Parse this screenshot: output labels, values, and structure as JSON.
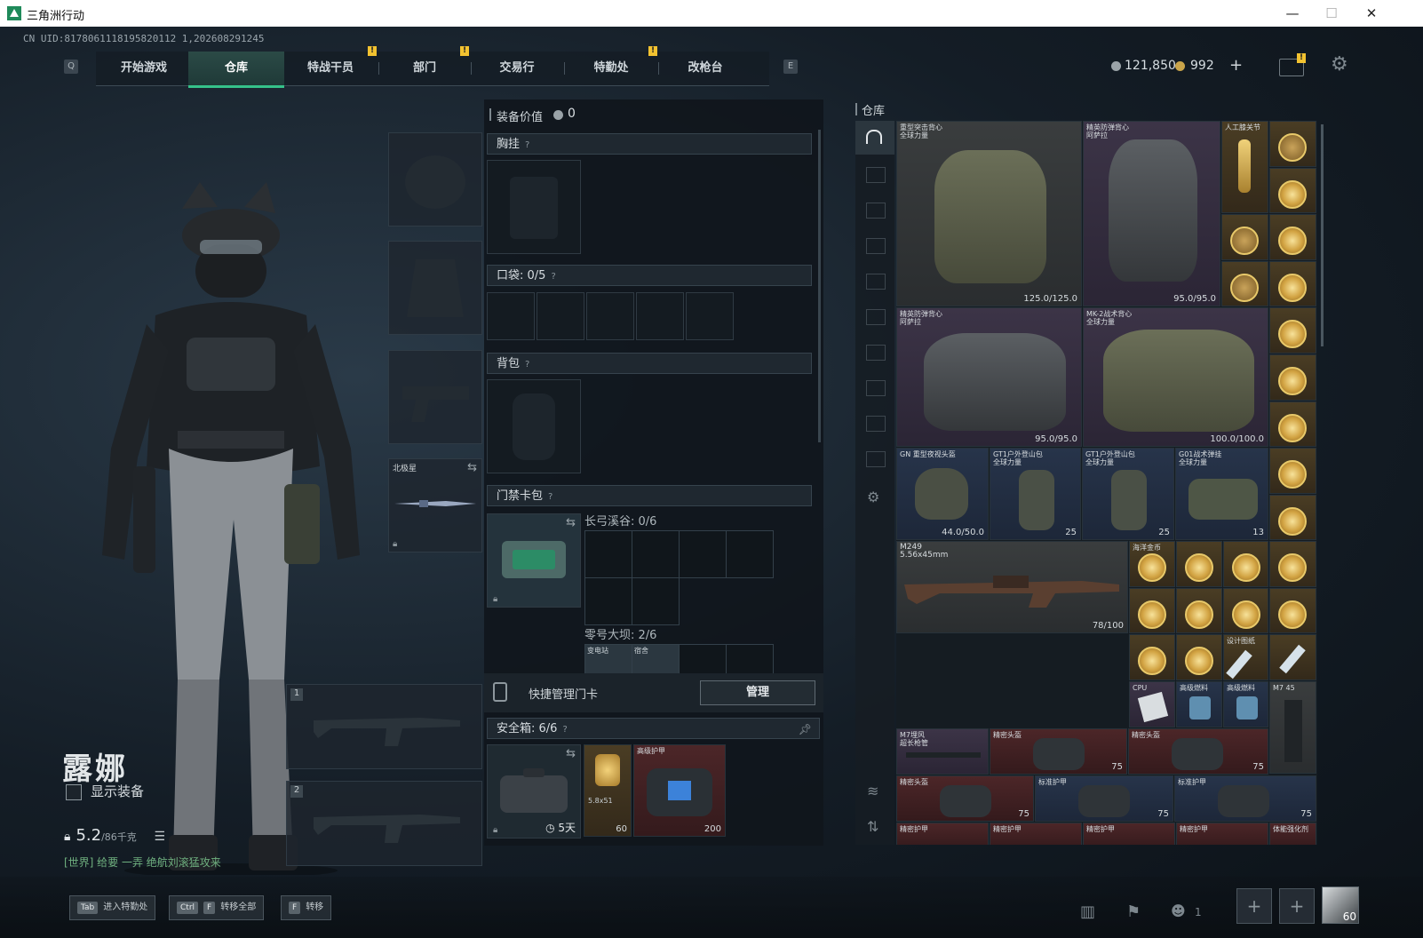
{
  "window": {
    "title": "三角洲行动",
    "minimize": "—",
    "maximize": "☐",
    "close": "✕"
  },
  "uid": "CN UID:8178061118195820112 1,202608291245",
  "nav": {
    "left_key": "Q",
    "right_key": "E",
    "tabs": [
      {
        "label": "开始游戏",
        "active": false,
        "badge": false
      },
      {
        "label": "仓库",
        "active": true,
        "badge": false
      },
      {
        "label": "特战干员",
        "active": false,
        "badge": true
      },
      {
        "label": "部门",
        "active": false,
        "badge": true
      },
      {
        "label": "交易行",
        "active": false,
        "badge": false
      },
      {
        "label": "特勤处",
        "active": false,
        "badge": true
      },
      {
        "label": "改枪台",
        "active": false,
        "badge": false
      }
    ],
    "badge_text": "!"
  },
  "currency": {
    "coins": "121,850",
    "premium": "992",
    "add": "+",
    "mail_badge": "!"
  },
  "operator": {
    "name": "露娜",
    "show_equipment": "显示装备",
    "weight": "5.2",
    "weight_max": "/86千克",
    "chat": "[世界] 给要 一弄 绝航刘滚猛攻来"
  },
  "equip_slots": {
    "melee_label": "北极星",
    "weapon1_num": "1",
    "weapon2_num": "2"
  },
  "loadout": {
    "value_label": "装备价值",
    "value": "0",
    "chest_rig": "胸挂",
    "pockets": "口袋: 0/5",
    "backpack": "背包",
    "keycard": "门禁卡包",
    "key1_label": "长弓溪谷: 0/6",
    "key2_label": "零号大坝: 2/6",
    "key2_items": [
      "变电站",
      "宿舍"
    ],
    "quick_manage": "快捷管理门卡",
    "manage": "管理",
    "safebox": "安全箱: 6/6",
    "safebox_timer": "5天",
    "safe_item1_name": "…",
    "safe_item1_ammo": "5.8x51",
    "safe_item1_count": "60",
    "safe_item2_name": "高级护甲",
    "safe_item2_dur": "200",
    "qmark": "?"
  },
  "warehouse": {
    "title": "仓库",
    "items": [
      {
        "name": "重型突击背心\n全球力量",
        "dur": "125.0/125.0"
      },
      {
        "name": "精英防弹背心\n阿萨拉",
        "dur": "95.0/95.0"
      },
      {
        "name": "人工膝关节",
        "dur": ""
      },
      {
        "name": "精英防弹背心\n阿萨拉",
        "dur": "95.0/95.0"
      },
      {
        "name": "MK-2战术背心\n全球力量",
        "dur": "100.0/100.0"
      },
      {
        "name": "GN 重型夜视头盔",
        "dur": "44.0/50.0"
      },
      {
        "name": "GT1户外登山包\n全球力量",
        "dur": "25"
      },
      {
        "name": "GT1户外登山包\n全球力量",
        "dur": "25"
      },
      {
        "name": "G01战术弹挂\n全球力量",
        "dur": "13"
      },
      {
        "name": "M249\n5.56x45mm",
        "dur": "78/100"
      },
      {
        "name": "海洋金币",
        "dur": ""
      },
      {
        "name": "设计图纸",
        "dur": ""
      },
      {
        "name": "CPU",
        "dur": ""
      },
      {
        "name": "高级燃料",
        "dur": ""
      },
      {
        "name": "M7 45",
        "dur": ""
      },
      {
        "name": "M7埋风\n超长枪管",
        "dur": ""
      },
      {
        "name": "精密头盔",
        "dur": "75"
      },
      {
        "name": "标准护甲",
        "dur": "75"
      },
      {
        "name": "精密护甲",
        "dur": ""
      },
      {
        "name": "体能强化剂",
        "dur": ""
      }
    ]
  },
  "bottom": {
    "tab_key": "Tab",
    "tab_label": "进入特勤处",
    "ctrl_key": "Ctrl",
    "f_key": "F",
    "ctrlf_label": "转移全部",
    "f_label": "转移",
    "team_count": "1",
    "level": "60"
  }
}
